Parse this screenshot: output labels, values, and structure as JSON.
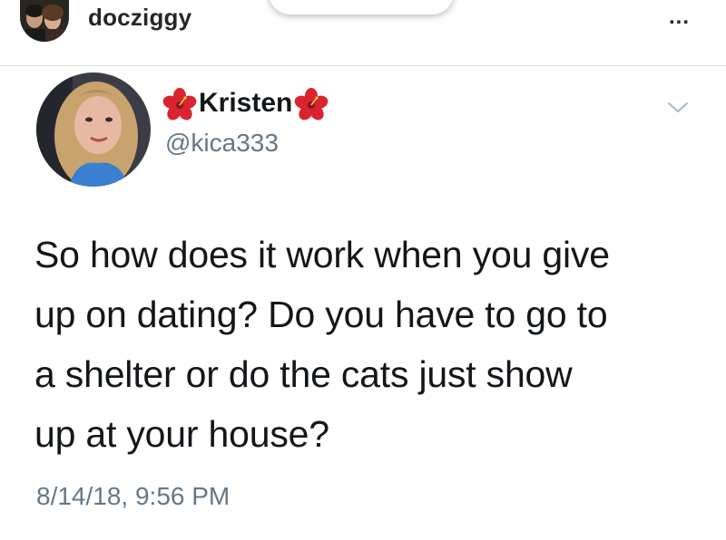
{
  "header": {
    "username": "docziggy",
    "more_label": "..."
  },
  "tweet": {
    "display_name": "Kristen",
    "handle": "@kica333",
    "name_decoration_icon": "hibiscus-flower-icon",
    "text_lines": [
      "So how does it work when you give",
      "up on dating? Do you have to go to",
      "a shelter or do the cats just show",
      "up at your house?"
    ],
    "timestamp": "8/14/18, 9:56 PM"
  },
  "colors": {
    "text": "#14171a",
    "secondary_text": "#657786",
    "flower": "#d9242f",
    "divider": "#dcdcdc"
  }
}
